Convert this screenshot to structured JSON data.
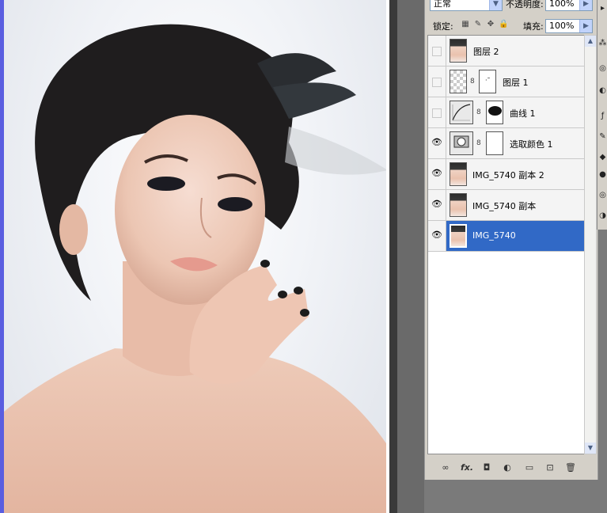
{
  "blend": {
    "mode": "正常",
    "opacity_label": "不透明度:",
    "opacity_value": "100%"
  },
  "lock": {
    "label": "锁定:",
    "fill_label": "填充:",
    "fill_value": "100%"
  },
  "layers": [
    {
      "name": "图层 2",
      "visible": false,
      "thumb": "photo",
      "mask": false,
      "selected": false
    },
    {
      "name": "图层 1",
      "visible": false,
      "thumb": "checker",
      "mask": true,
      "selected": false
    },
    {
      "name": "曲线 1",
      "visible": false,
      "thumb": "curves",
      "mask": true,
      "selected": false
    },
    {
      "name": "选取颜色 1",
      "visible": true,
      "thumb": "selective-color",
      "mask": true,
      "selected": false
    },
    {
      "name": "IMG_5740 副本 2",
      "visible": true,
      "thumb": "photo",
      "mask": false,
      "selected": false
    },
    {
      "name": "IMG_5740 副本",
      "visible": true,
      "thumb": "photo",
      "mask": false,
      "selected": false
    },
    {
      "name": "IMG_5740",
      "visible": true,
      "thumb": "photo",
      "mask": false,
      "selected": true
    }
  ],
  "footer_icons": [
    "link-layers-icon",
    "fx-icon",
    "add-mask-icon",
    "adjustment-layer-icon",
    "new-group-icon",
    "new-layer-icon",
    "trash-icon"
  ],
  "footer_glyphs": {
    "link": "∞",
    "fx": "fx.",
    "mask": "◘",
    "adjust": "◐",
    "group": "▭",
    "new": "⊡",
    "trash": "🗑"
  },
  "colors": {
    "selection": "#3169c6",
    "panel_bg": "#d4d0c8",
    "doc_edge": "#5a5ee0"
  }
}
